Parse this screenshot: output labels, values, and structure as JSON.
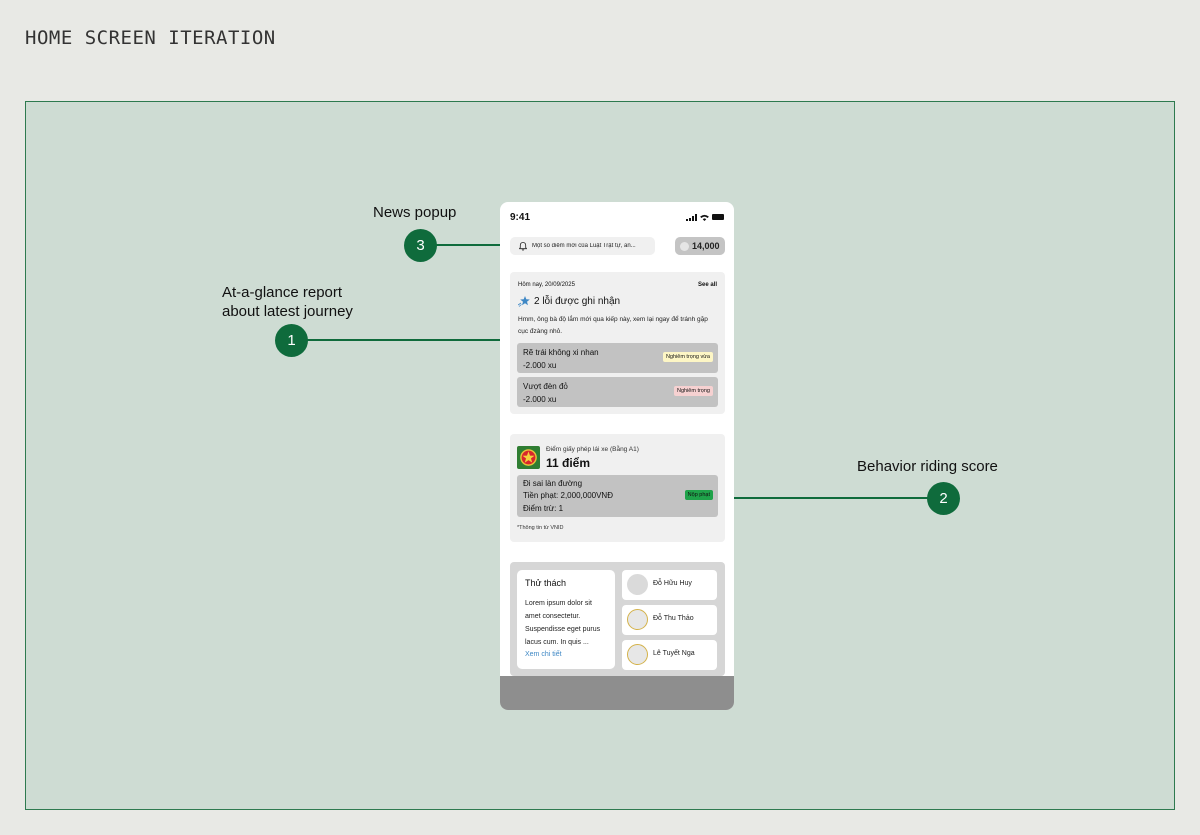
{
  "page_title": "HOME SCREEN ITERATION",
  "annotations": {
    "news": {
      "label": "News popup",
      "number": "3"
    },
    "report": {
      "label_line1": "At-a-glance report",
      "label_line2": "about latest journey",
      "number": "1"
    },
    "behavior": {
      "label": "Behavior riding score",
      "number": "2"
    }
  },
  "phone": {
    "status": {
      "time": "9:41"
    },
    "news": {
      "text": "Một số điểm mới của Luật Trật tự, an..."
    },
    "coins": {
      "value": "14,000"
    },
    "report": {
      "date": "Hôm nay, 20/09/2025",
      "see_all": "See all",
      "title": "2 lỗi được ghi nhận",
      "description": "Hmm, ông bà độ lắm mới qua kiếp này, xem lại ngay để tránh gặp cục đzàng nhỏ.",
      "violations": [
        {
          "name": "Rẽ trái không xi nhan",
          "fine": "-2.000 xu",
          "severity": "Nghiêm trọng vừa"
        },
        {
          "name": "Vượt đèn đỏ",
          "fine": "-2.000 xu",
          "severity": "Nghiêm trọng"
        }
      ]
    },
    "license": {
      "subtitle": "Điểm giấy phép lái xe (Bằng A1)",
      "score": "11 điểm",
      "penalty": {
        "name": "Đi sai làn đường",
        "fine": "Tiền phạt: 2,000,000VNĐ",
        "points": "Điểm trừ: 1",
        "pay_label": "Nộp phạt"
      },
      "source": "*Thông tin từ VNID"
    },
    "challenge": {
      "title": "Thử thách",
      "body": "Lorem ipsum dolor sit amet consectetur. Suspendisse eget purus lacus cum. In quis ...",
      "link": "Xem chi tiết",
      "friends": [
        "Đỗ Hữu Huy",
        "Đỗ Thu Thảo",
        "Lê Tuyết Nga"
      ]
    }
  },
  "colors": {
    "background": "#e8e9e5",
    "canvas": "#cedcd3",
    "accent": "#0f6b3c",
    "severity_mid": "#fdf6c5",
    "severity_high": "#f6d1d1",
    "pay_button": "#1fa24a",
    "link": "#3f88c5"
  }
}
